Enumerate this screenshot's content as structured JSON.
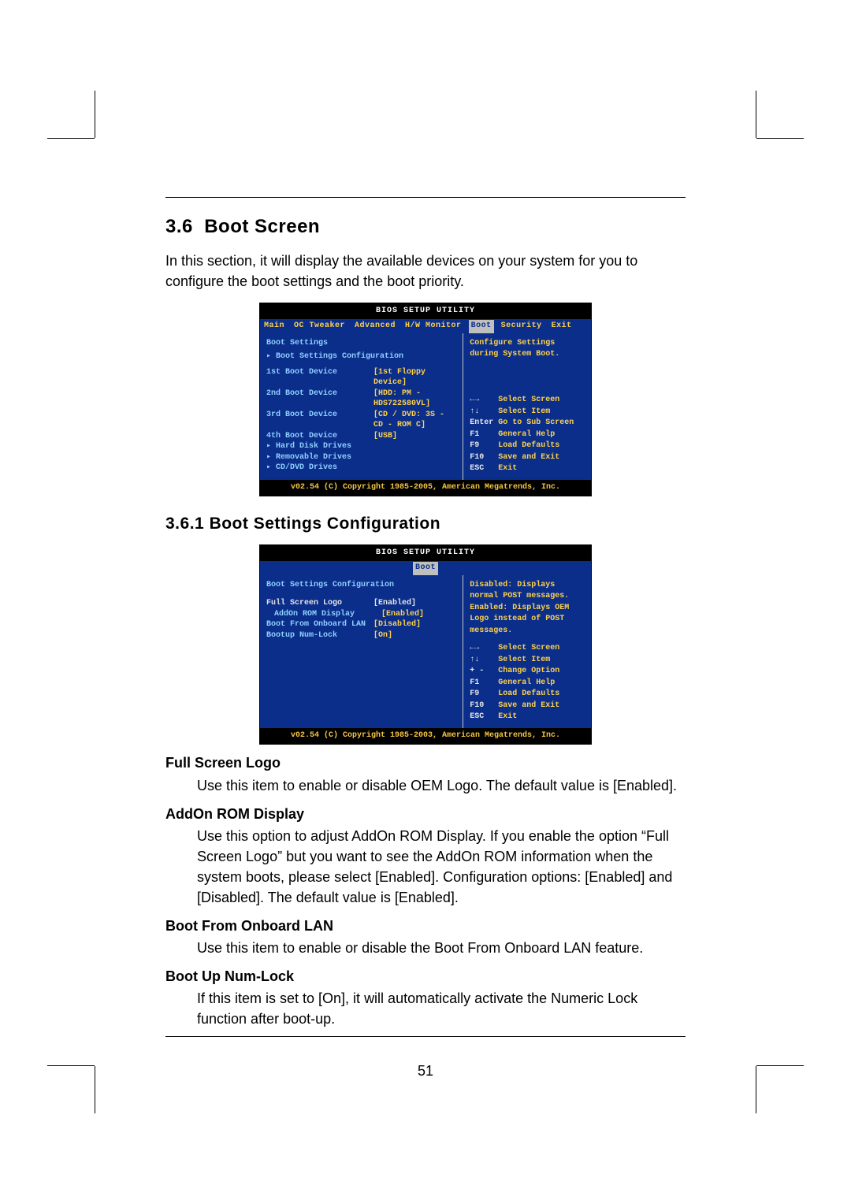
{
  "page_number": "51",
  "section": {
    "number": "3.6",
    "title": "Boot Screen",
    "intro": "In this section, it will display the available devices on your system for you to configure the boot settings and the boot priority."
  },
  "subsection": {
    "number": "3.6.1",
    "title": "Boot Settings Configuration"
  },
  "bios1": {
    "title": "BIOS SETUP UTILITY",
    "tabs": [
      "Main",
      "OC Tweaker",
      "Advanced",
      "H/W Monitor",
      "Boot",
      "Security",
      "Exit"
    ],
    "active_tab": "Boot",
    "left_heading": "Boot Settings",
    "left_subheading": "Boot Settings Configuration",
    "rows": [
      {
        "label": "1st Boot Device",
        "value": "[1st  Floppy Device]"
      },
      {
        "label": "2nd Boot Device",
        "value": "[HDD: PM - HDS722580VL]"
      },
      {
        "label": "3rd Boot Device",
        "value": "[CD / DVD: 3S - CD - ROM C]"
      },
      {
        "label": "4th Boot Device",
        "value": "[USB]"
      }
    ],
    "trailing": [
      "Hard Disk Drives",
      "Removable Drives",
      "CD/DVD Drives"
    ],
    "right_help": [
      "Configure Settings",
      "during System Boot."
    ],
    "keys": [
      {
        "k": "←→",
        "t": "Select Screen"
      },
      {
        "k": "↑↓",
        "t": "Select Item"
      },
      {
        "k": "Enter",
        "t": "Go to Sub Screen"
      },
      {
        "k": "F1",
        "t": "General Help"
      },
      {
        "k": "F9",
        "t": "Load Defaults"
      },
      {
        "k": "F10",
        "t": "Save and Exit"
      },
      {
        "k": "ESC",
        "t": "Exit"
      }
    ],
    "copyright": "v02.54 (C) Copyright 1985-2005, American Megatrends, Inc."
  },
  "bios2": {
    "title": "BIOS SETUP UTILITY",
    "active_tab": "Boot",
    "left_heading": "Boot Settings Configuration",
    "rows": [
      {
        "label": "Full Screen Logo",
        "value": "[Enabled]",
        "selected": true
      },
      {
        "label": "AddOn ROM Display",
        "value": "[Enabled]",
        "indent": true
      },
      {
        "label": "Boot From Onboard LAN",
        "value": "[Disabled]"
      },
      {
        "label": "Bootup Num-Lock",
        "value": "[On]"
      }
    ],
    "right_help": [
      "Disabled: Displays",
      "normal POST messages.",
      "Enabled: Displays OEM",
      "Logo instead of POST",
      "messages."
    ],
    "keys": [
      {
        "k": "←→",
        "t": "Select Screen"
      },
      {
        "k": "↑↓",
        "t": "Select Item"
      },
      {
        "k": "+ -",
        "t": "Change Option"
      },
      {
        "k": "F1",
        "t": "General Help"
      },
      {
        "k": "F9",
        "t": "Load Defaults"
      },
      {
        "k": "F10",
        "t": "Save and Exit"
      },
      {
        "k": "ESC",
        "t": "Exit"
      }
    ],
    "copyright": "v02.54 (C) Copyright 1985-2003, American Megatrends, Inc."
  },
  "options": [
    {
      "title": "Full Screen Logo",
      "desc": "Use this item to enable or disable OEM Logo. The default value is [Enabled]."
    },
    {
      "title": "AddOn ROM Display",
      "desc": "Use this option to adjust AddOn ROM Display. If you enable the option “Full Screen Logo” but you want to see the AddOn ROM information when the system boots, please select [Enabled]. Configuration options: [Enabled] and [Disabled]. The default value is [Enabled]."
    },
    {
      "title": "Boot From Onboard LAN",
      "desc": "Use this item to enable or disable the Boot From Onboard LAN feature."
    },
    {
      "title": "Boot Up Num-Lock",
      "desc": "If this item is set to [On], it will automatically activate the Numeric Lock function after boot-up."
    }
  ]
}
